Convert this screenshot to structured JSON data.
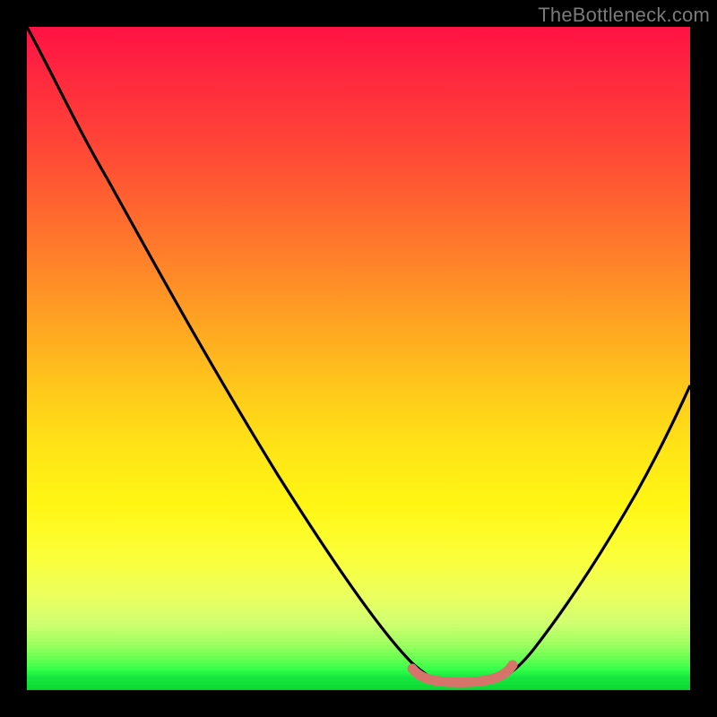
{
  "watermark": "TheBottleneck.com",
  "chart_data": {
    "type": "line",
    "title": "",
    "xlabel": "",
    "ylabel": "",
    "xlim": [
      0,
      100
    ],
    "ylim": [
      0,
      100
    ],
    "grid": false,
    "series": [
      {
        "name": "bottleneck-curve",
        "x": [
          0,
          5,
          12,
          20,
          28,
          36,
          44,
          52,
          58,
          62,
          66,
          70,
          74,
          80,
          86,
          92,
          100
        ],
        "values": [
          100,
          92,
          82,
          70,
          58,
          46,
          34,
          22,
          12,
          6,
          2,
          2,
          4,
          10,
          20,
          32,
          48
        ]
      },
      {
        "name": "optimal-range-marker",
        "x": [
          60,
          62,
          66,
          70,
          72
        ],
        "values": [
          3,
          2,
          2,
          2,
          3
        ]
      }
    ],
    "colors": {
      "curve": "#000000",
      "marker": "#d6736b",
      "gradient_top": "#ff1244",
      "gradient_mid": "#ffe516",
      "gradient_bottom": "#08d830",
      "frame": "#000000"
    }
  }
}
